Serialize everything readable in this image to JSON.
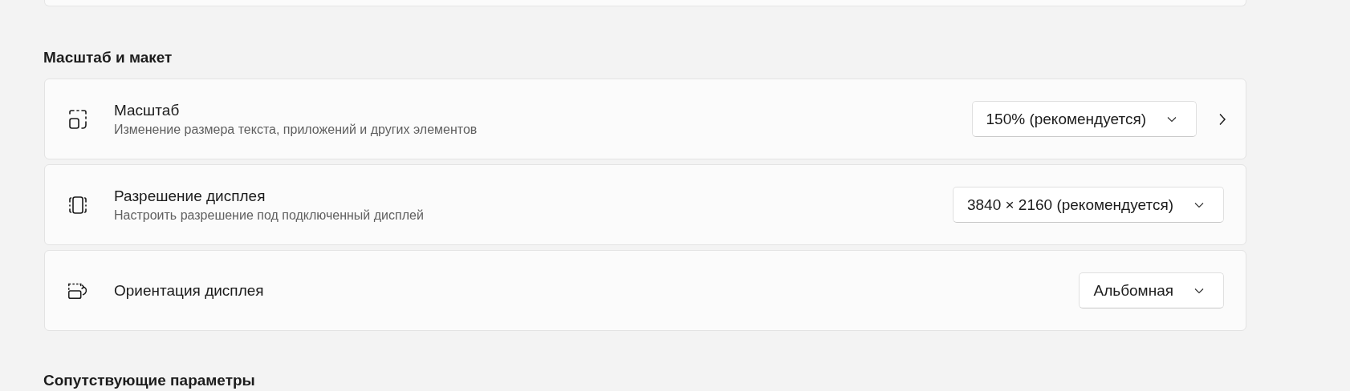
{
  "section_title": "Масштаб и макет",
  "settings": [
    {
      "title": "Масштаб",
      "description": "Изменение размера текста, приложений и других элементов",
      "value": "150% (рекомендуется)",
      "navigate": true
    },
    {
      "title": "Разрешение дисплея",
      "description": "Настроить разрешение под подключенный дисплей",
      "value": "3840 × 2160 (рекомендуется)",
      "navigate": false
    },
    {
      "title": "Ориентация дисплея",
      "value": "Альбомная",
      "navigate": false
    }
  ],
  "next_section_title": "Сопутствующие параметры"
}
